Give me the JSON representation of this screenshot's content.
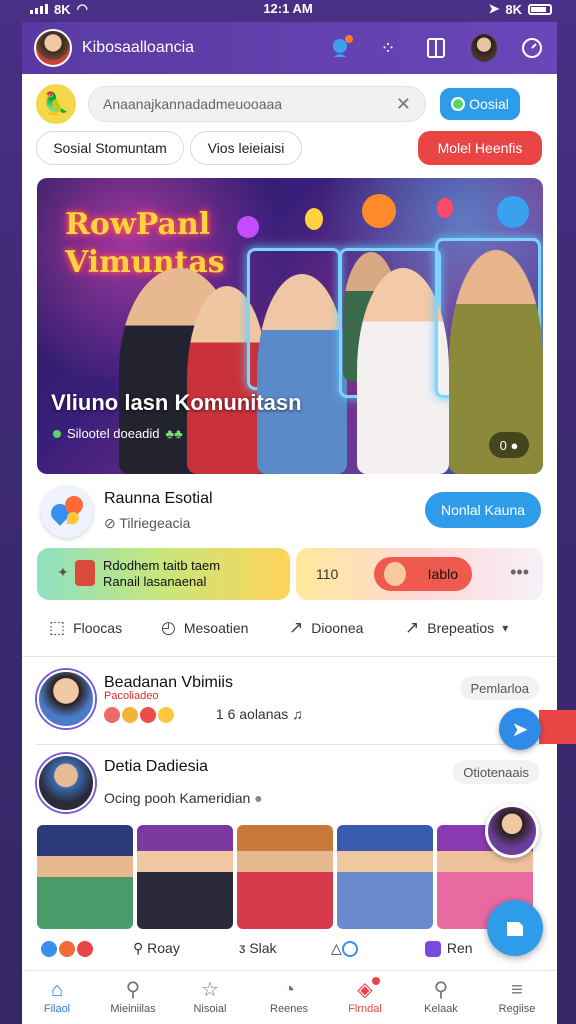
{
  "statusbar": {
    "carrier": "8K",
    "time": "12:1 AM",
    "battery": "8K"
  },
  "header": {
    "title": "Kibosaalloancia"
  },
  "search": {
    "placeholder": "Anaanajkannadadmeuooaaa",
    "social_button": "Oosial"
  },
  "chips": [
    "Sosial Stomuntam",
    "Vios leieiaisi",
    "Molel Heenfis"
  ],
  "hero": {
    "neon_line1": "RowPanl",
    "neon_line2": "Vimuntas",
    "caption": "Vliuno lasn Komunitasn",
    "subtitle": "Silootel doeadid",
    "mini": "0 ●"
  },
  "community": {
    "name": "Raunna Esotial",
    "meta": "⊘ Tilriegeacia",
    "join_button": "Nonlal Kauna"
  },
  "cards": {
    "card1_line1": "Rdodhem taitb taem",
    "card1_line2": "Ranail lasanaenal",
    "card2_count": "110",
    "card2_pill": "Iablo"
  },
  "actions": [
    "Floocas",
    "Mesoatien",
    "Dioonea",
    "Brepeatios"
  ],
  "posts": [
    {
      "name": "Beadanan Vbimiis",
      "sub": "Pacoliadeo",
      "info": "1 6 aolanas",
      "tag": "Pemlarloa"
    },
    {
      "name": "Detia Dadiesia",
      "sub": "",
      "info": "Ocing pooh Kameridian",
      "tag": "Otiotenaais"
    }
  ],
  "reactbar": {
    "item2": "Roay",
    "item3": "Slak",
    "item4": "Ren"
  },
  "bottomnav": [
    "Filaol",
    "Mieiniilas",
    "Nisoial",
    "Reenes",
    "Flrndal",
    "Kelaak",
    "Regiise"
  ],
  "colors": {
    "accent": "#2e9ce8",
    "brand": "#5a3aa2",
    "alert": "#e94545"
  }
}
